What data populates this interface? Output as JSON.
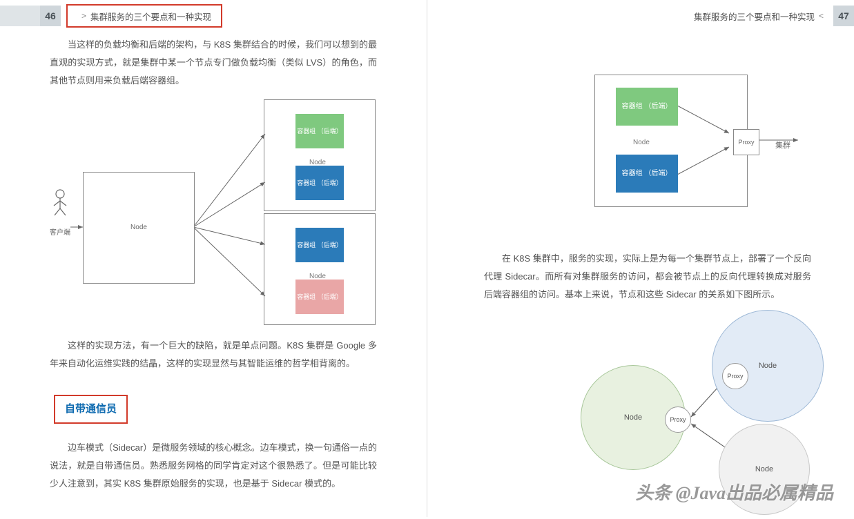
{
  "doc": {
    "chapter_title": "集群服务的三个要点和一种实现",
    "left_page_no": "46",
    "right_page_no": "47"
  },
  "left": {
    "para1": "当这样的负载均衡和后端的架构，与 K8S 集群结合的时候，我们可以想到的最直观的实现方式，就是集群中某一个节点专门做负载均衡（类似 LVS）的角色，而其他节点则用来负载后端容器组。",
    "para2": "这样的实现方法，有一个巨大的缺陷，就是单点问题。K8S 集群是 Google 多年来自动化运维实践的结晶，这样的实现显然与其智能运维的哲学相背离的。",
    "section_heading": "自带通信员",
    "para3": "边车模式（Sidecar）是微服务领域的核心概念。边车模式，换一句通俗一点的说法，就是自带通信员。熟悉服务网格的同学肯定对这个很熟悉了。但是可能比较少人注意到，其实 K8S 集群原始服务的实现，也是基于 Sidecar 模式的。",
    "diagram1": {
      "client_label": "客户端",
      "node_big": "Node",
      "node_label": "Node",
      "container_label": "容器组\n（后端）"
    }
  },
  "right": {
    "para1": "在 K8S 集群中，服务的实现，实际上是为每一个集群节点上，部署了一个反向代理 Sidecar。而所有对集群服务的访问，都会被节点上的反向代理转换成对服务后端容器组的访问。基本上来说，节点和这些 Sidecar 的关系如下图所示。",
    "diagram2": {
      "node_label": "Node",
      "container_label": "容器组\n（后端）",
      "proxy_label": "Proxy",
      "cluster_label": "集群"
    },
    "diagram3": {
      "node_label": "Node",
      "proxy_label": "Proxy"
    }
  },
  "watermark": "头条 @Java出品必属精品"
}
